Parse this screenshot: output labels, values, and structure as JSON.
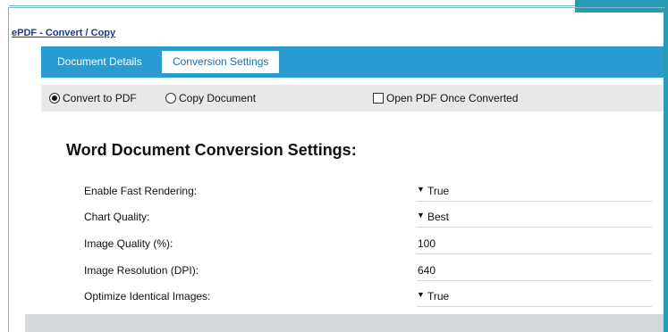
{
  "dialog": {
    "title": "ePDF - Convert / Copy"
  },
  "tabs": [
    {
      "label": "Document Details",
      "active": false
    },
    {
      "label": "Conversion Settings",
      "active": true
    }
  ],
  "options": {
    "convert_to_pdf": {
      "label": "Convert to PDF",
      "selected": true
    },
    "copy_document": {
      "label": "Copy Document",
      "selected": false
    },
    "open_pdf": {
      "label": "Open PDF Once Converted",
      "checked": false
    }
  },
  "settings": {
    "heading": "Word Document Conversion Settings:",
    "rows": [
      {
        "label": "Enable Fast Rendering:",
        "value": "True",
        "dropdown": true
      },
      {
        "label": "Chart Quality:",
        "value": "Best",
        "dropdown": true
      },
      {
        "label": "Image Quality (%):",
        "value": "100",
        "dropdown": false
      },
      {
        "label": "Image Resolution (DPI):",
        "value": "640",
        "dropdown": false
      },
      {
        "label": "Optimize Identical Images:",
        "value": "True",
        "dropdown": true
      }
    ]
  },
  "colors": {
    "tabbar": "#2a9bd0",
    "accent_teal": "#2a9bb6",
    "option_bar": "#e8e8e8"
  }
}
